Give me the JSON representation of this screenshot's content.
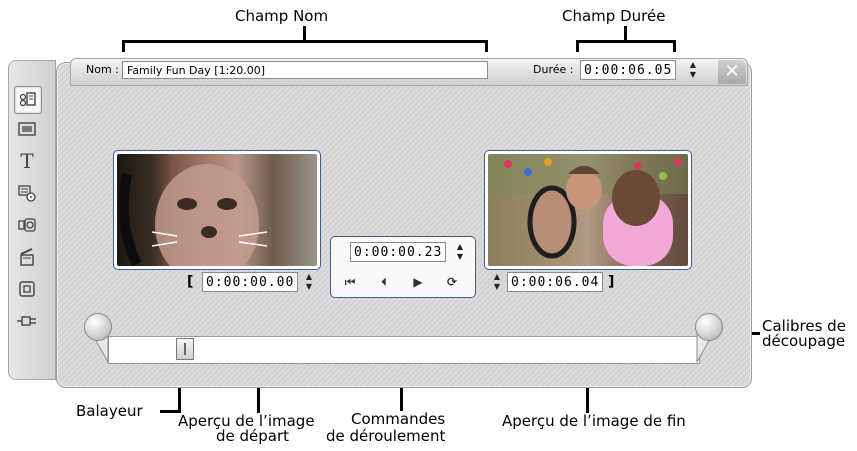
{
  "callouts": {
    "name_field": "Champ Nom",
    "duration_field": "Champ Durée",
    "trim_calipers_line1": "Calibres de",
    "trim_calipers_line2": "découpage",
    "scrubber": "Balayeur",
    "start_preview_line1": "Aperçu de l’image",
    "start_preview_line2": "de départ",
    "playback_line1": "Commandes",
    "playback_line2": "de déroulement",
    "end_preview": "Aperçu de l’image de fin"
  },
  "header": {
    "name_label": "Nom :",
    "name_value": "Family Fun Day [1:20.00]",
    "duration_label": "Durée :",
    "duration_value": "0:00:06.05",
    "close_glyph": "✕"
  },
  "toolbar": {
    "icons": [
      "video-clip-icon",
      "photo-icon",
      "title-icon",
      "disc-menu-icon",
      "sound-effects-icon",
      "slideshow-icon",
      "square-icon",
      "plugin-icon"
    ],
    "title_glyph": "T"
  },
  "start_preview": {
    "bracket": "[",
    "timecode": "0:00:00.00"
  },
  "end_preview": {
    "bracket": "]",
    "timecode": "0:00:06.04"
  },
  "transport": {
    "timecode": "0:00:00.23",
    "buttons": [
      "⏮",
      "⏴",
      "▶",
      "⟳"
    ]
  },
  "colors": {
    "frame_border": "#3a5f99",
    "panel_bg": "#d8d8d8",
    "close_bg": "#b9b9b9"
  }
}
